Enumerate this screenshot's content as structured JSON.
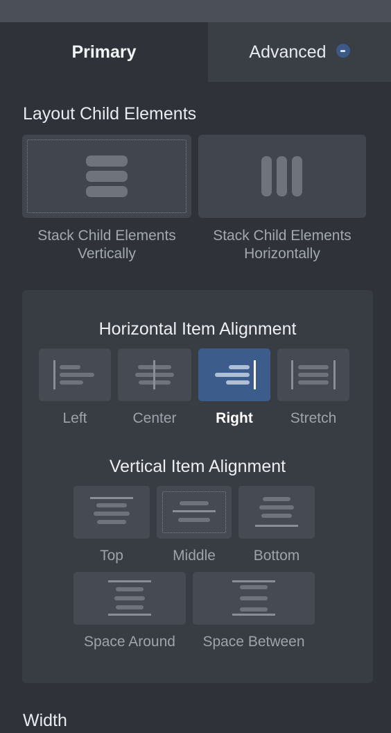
{
  "tabs": {
    "primary": "Primary",
    "advanced": "Advanced"
  },
  "layout": {
    "title": "Layout Child Elements",
    "vertical": {
      "line1": "Stack Child Elements",
      "line2": "Vertically"
    },
    "horizontal": {
      "line1": "Stack Child Elements",
      "line2": "Horizontally"
    }
  },
  "horizontal_alignment": {
    "title": "Horizontal Item Alignment",
    "options": [
      "Left",
      "Center",
      "Right",
      "Stretch"
    ],
    "selected": "Right"
  },
  "vertical_alignment": {
    "title": "Vertical Item Alignment",
    "options": [
      "Top",
      "Middle",
      "Bottom",
      "Space Around",
      "Space Between"
    ],
    "selected": "Middle"
  },
  "width": {
    "title": "Width"
  },
  "colors": {
    "background": "#2f3339",
    "panel": "#383c43",
    "tile": "#464b53",
    "accent": "#3c5d8b"
  }
}
